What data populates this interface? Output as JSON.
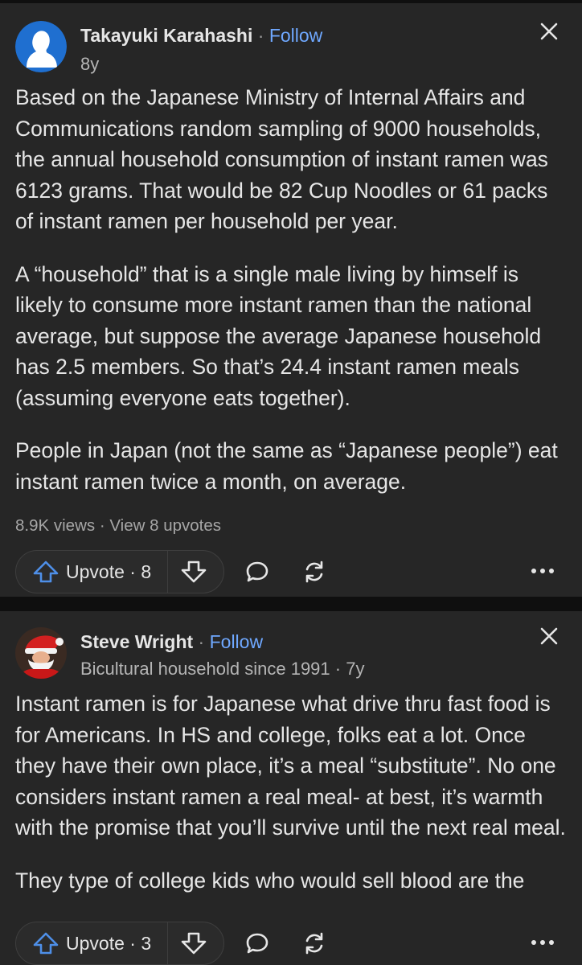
{
  "answers": [
    {
      "author": "Takayuki Karahashi",
      "separator": "·",
      "follow_label": "Follow",
      "meta": "8y",
      "paragraphs": [
        "Based on the Japanese Ministry of Internal Affairs and Communications random sampling of 9000 households, the annual household consumption of instant ramen was 6123 grams. That would be 82 Cup Noodles or 61 packs of instant ramen per household per year.",
        "A “household” that is a single male living by himself is likely to consume more instant ramen than the national average, but suppose the average Japanese household has 2.5 members. So that’s 24.4 instant ramen meals (assuming everyone eats together).",
        "People in Japan (not the same as “Japanese people”) eat instant ramen twice a month, on average."
      ],
      "stats": "8.9K views · View 8 upvotes",
      "upvote_label": "Upvote · 8"
    },
    {
      "author": "Steve Wright",
      "separator": "·",
      "follow_label": "Follow",
      "meta": "Bicultural household since 1991 · 7y",
      "paragraphs": [
        "Instant ramen is for Japanese what drive thru fast food is for Americans. In HS and college, folks eat a lot. Once they have their own place, it’s a meal “substitute”. No one considers instant ramen a real meal- at best, it’s warmth with the promise that you’ll survive until the next real meal.",
        "They type of college kids who would sell blood are the"
      ],
      "upvote_label": "Upvote · 3"
    }
  ],
  "icons": {
    "close": "close-icon",
    "upvote": "upvote-arrow-icon",
    "downvote": "downvote-arrow-icon",
    "comment": "comment-icon",
    "share": "share-icon",
    "more": "more-icon"
  },
  "colors": {
    "background": "#0f0f0f",
    "card": "#262626",
    "accent": "#6fa8ff",
    "upvote_icon": "#4e8fe8"
  }
}
